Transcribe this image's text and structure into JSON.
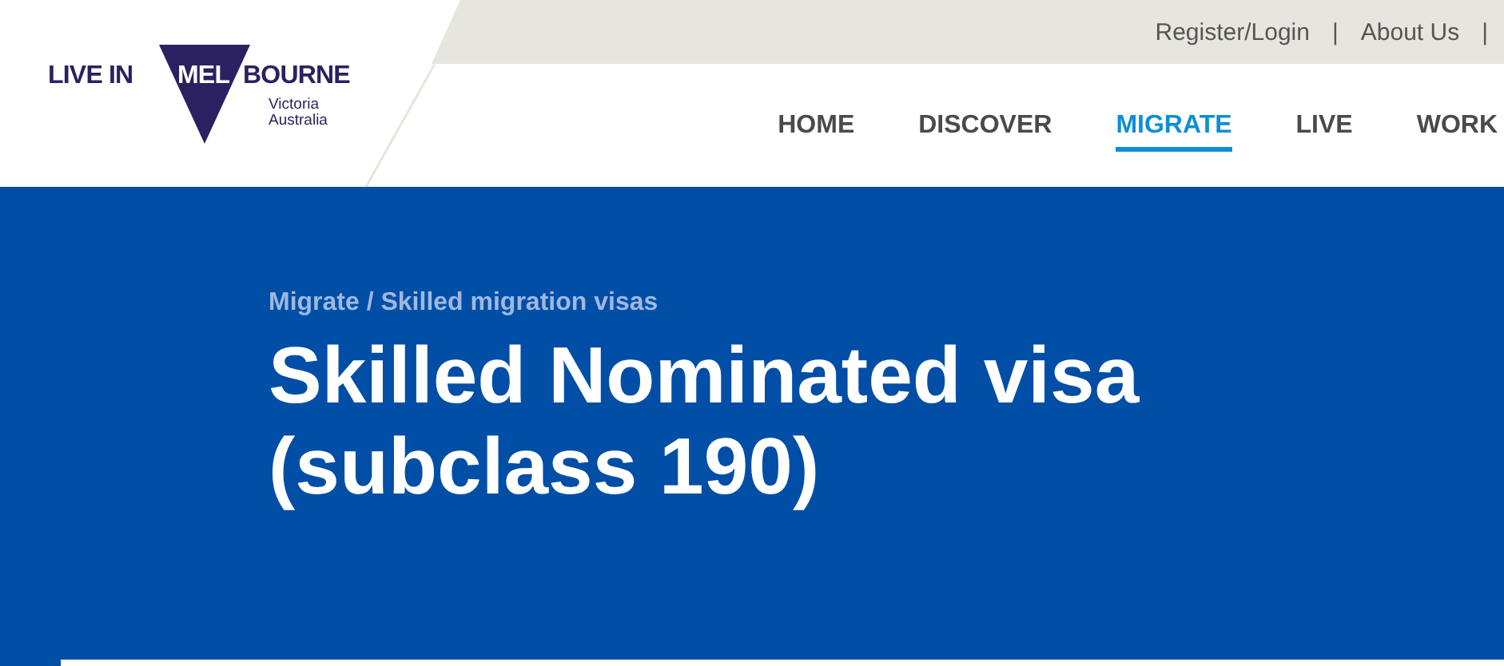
{
  "logo": {
    "prefix": "LIVE IN ",
    "highlight": "MEL",
    "suffix": "BOURNE",
    "region": "Victoria",
    "country": "Australia"
  },
  "utility_links": [
    {
      "label": "Register/Login",
      "separator": "|"
    },
    {
      "label": "About Us",
      "separator": "|"
    }
  ],
  "nav": [
    {
      "label": "HOME",
      "selected": false
    },
    {
      "label": "DISCOVER",
      "selected": false
    },
    {
      "label": "MIGRATE",
      "selected": true
    },
    {
      "label": "LIVE",
      "selected": false
    },
    {
      "label": "WORK",
      "selected": false
    }
  ],
  "breadcrumb": "Migrate / Skilled migration visas",
  "title_lines": [
    "Skilled Nominated visa",
    "(subclass 190)"
  ]
}
